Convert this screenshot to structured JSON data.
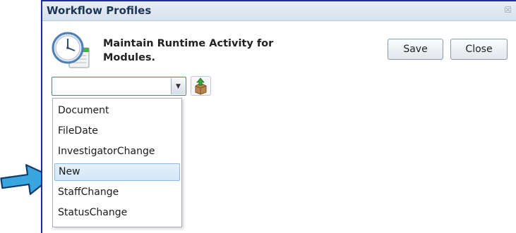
{
  "window": {
    "title": "Workflow Profiles",
    "close_glyph": "☒"
  },
  "header": {
    "icon": "clock-calendar-icon",
    "heading_line1": "Maintain Runtime Activity for",
    "heading_line2": "Modules."
  },
  "toolbar": {
    "save_label": "Save",
    "close_label": "Close",
    "add_icon": "add-box-icon"
  },
  "combo": {
    "value": "",
    "options": [
      "Document",
      "FileDate",
      "InvestigatorChange",
      "New",
      "StaffChange",
      "StatusChange"
    ],
    "highlighted": "New"
  },
  "colors": {
    "frame": "#1f2f98",
    "pointer": "#3aa6e0",
    "highlight": "#d3e6f7"
  }
}
